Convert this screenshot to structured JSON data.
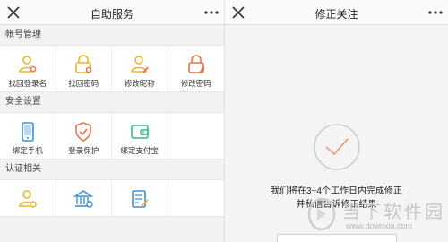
{
  "left": {
    "title": "自助服务",
    "sections": [
      {
        "title": "帐号管理",
        "items": [
          {
            "label": "找回登录名",
            "icon": "user-search-icon"
          },
          {
            "label": "找回密码",
            "icon": "lock-search-icon"
          },
          {
            "label": "修改昵称",
            "icon": "user-edit-icon"
          },
          {
            "label": "修改密码",
            "icon": "lock-edit-icon"
          }
        ]
      },
      {
        "title": "安全设置",
        "items": [
          {
            "label": "绑定手机",
            "icon": "phone-icon"
          },
          {
            "label": "登录保护",
            "icon": "shield-check-icon"
          },
          {
            "label": "绑定支付宝",
            "icon": "wallet-icon"
          }
        ]
      },
      {
        "title": "认证相关",
        "items": [
          {
            "label": "",
            "icon": "user-verify-icon"
          },
          {
            "label": "",
            "icon": "bank-verify-icon"
          },
          {
            "label": "",
            "icon": "document-edit-icon"
          }
        ]
      }
    ]
  },
  "right": {
    "title": "修正关注",
    "message_line1": "我们将在3~4个工作日内完成修正",
    "message_line2": "并私信告诉修正结果"
  },
  "watermark": {
    "text": "当下软件园",
    "url": "www.downxia.com"
  },
  "colors": {
    "accent_yellow": "#f0b429",
    "accent_orange": "#e8734e",
    "accent_blue": "#3d8fd9",
    "accent_green": "#3cb98a",
    "check_gray": "#cfcfcf"
  }
}
